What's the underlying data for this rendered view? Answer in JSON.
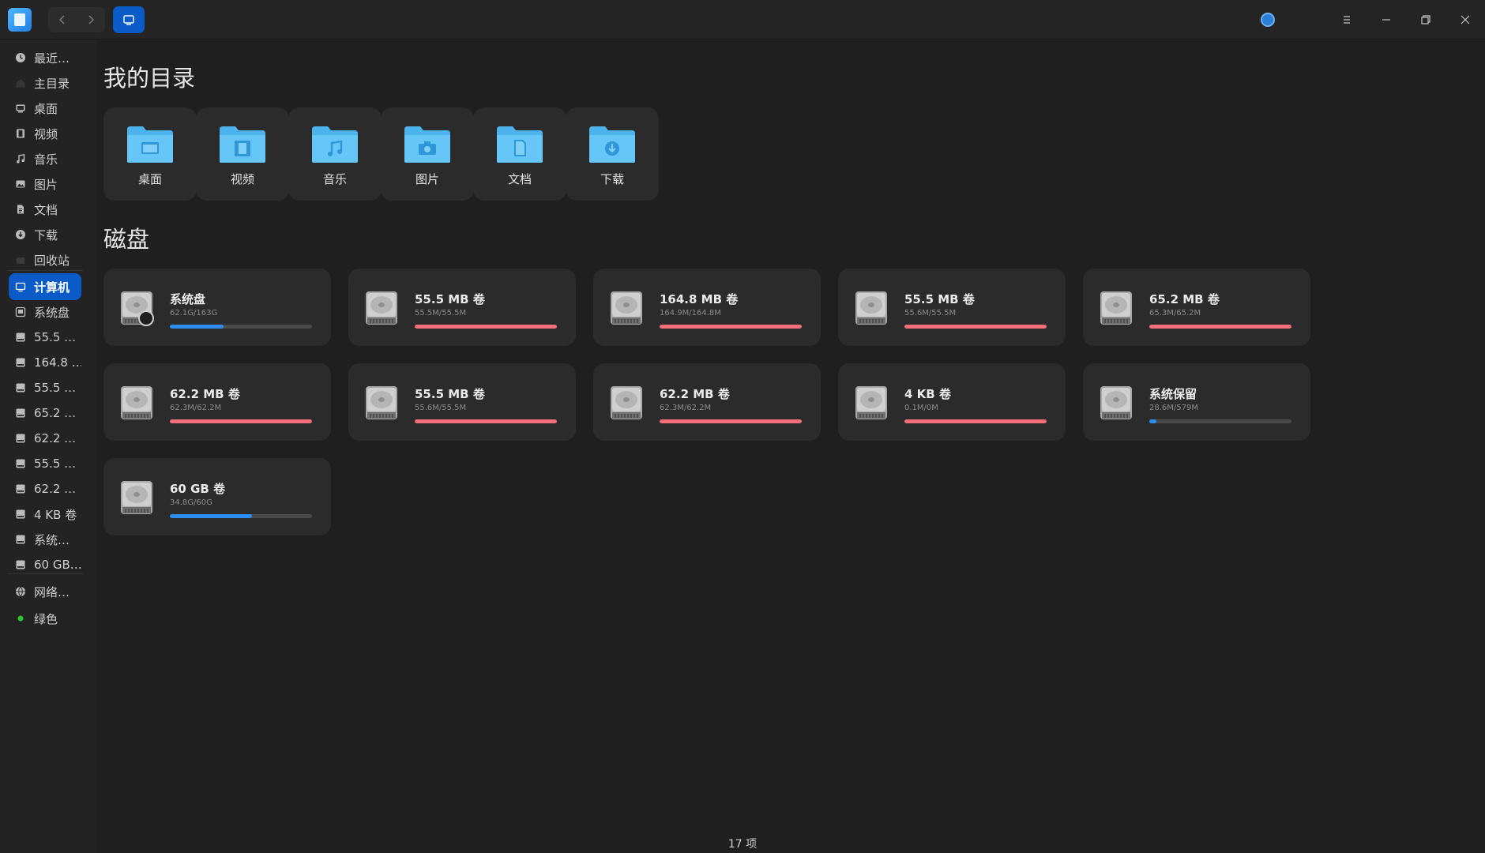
{
  "window": {
    "colors": {
      "accent": "#0a5bc7",
      "bar_blue": "#2c8ef0",
      "bar_red": "#f46f7a",
      "folder": "#5ec1f5"
    }
  },
  "titlebar": {
    "icons": [
      "app-logo",
      "back-icon",
      "forward-icon",
      "computer-view-icon",
      "status-icon",
      "menu-icon",
      "minimize-icon",
      "restore-icon",
      "close-icon"
    ]
  },
  "sidebar": {
    "items": [
      {
        "label": "最近…",
        "icon": "clock-icon"
      },
      {
        "label": "主目录",
        "icon": "home-icon"
      },
      {
        "label": "桌面",
        "icon": "desktop-icon"
      },
      {
        "label": "视频",
        "icon": "film-icon"
      },
      {
        "label": "音乐",
        "icon": "music-icon"
      },
      {
        "label": "图片",
        "icon": "image-icon"
      },
      {
        "label": "文档",
        "icon": "document-icon"
      },
      {
        "label": "下载",
        "icon": "download-icon"
      },
      {
        "label": "回收站",
        "icon": "trash-icon"
      },
      {
        "label": "计算机",
        "icon": "computer-icon"
      },
      {
        "label": "系统盘",
        "icon": "system-disk-icon"
      },
      {
        "label": "55.5 …",
        "icon": "disk-icon"
      },
      {
        "label": "164.8 …",
        "icon": "disk-icon"
      },
      {
        "label": "55.5 …",
        "icon": "disk-icon"
      },
      {
        "label": "65.2 …",
        "icon": "disk-icon"
      },
      {
        "label": "62.2 …",
        "icon": "disk-icon"
      },
      {
        "label": "55.5 …",
        "icon": "disk-icon"
      },
      {
        "label": "62.2 …",
        "icon": "disk-icon"
      },
      {
        "label": "4 KB 卷",
        "icon": "disk-icon"
      },
      {
        "label": "系统…",
        "icon": "disk-icon"
      },
      {
        "label": "60 GB…",
        "icon": "disk-icon"
      },
      {
        "label": "网络…",
        "icon": "network-icon"
      },
      {
        "label": "绿色",
        "icon": "green-tag-icon"
      }
    ]
  },
  "main": {
    "directories_title": "我的目录",
    "directories": [
      {
        "label": "桌面",
        "icon": "desktop-folder-icon"
      },
      {
        "label": "视频",
        "icon": "video-folder-icon"
      },
      {
        "label": "音乐",
        "icon": "music-folder-icon"
      },
      {
        "label": "图片",
        "icon": "pictures-folder-icon"
      },
      {
        "label": "文档",
        "icon": "documents-folder-icon"
      },
      {
        "label": "下载",
        "icon": "downloads-folder-icon"
      }
    ],
    "disks_title": "磁盘",
    "disks": [
      {
        "name": "系统盘",
        "usage": "62.1G/163G",
        "fraction": 0.38,
        "color": "#2c8ef0"
      },
      {
        "name": "55.5 MB 卷",
        "usage": "55.5M/55.5M",
        "fraction": 1.0,
        "color": "#f46f7a"
      },
      {
        "name": "164.8 MB 卷",
        "usage": "164.9M/164.8M",
        "fraction": 1.0,
        "color": "#f46f7a"
      },
      {
        "name": "55.5 MB 卷",
        "usage": "55.6M/55.5M",
        "fraction": 1.0,
        "color": "#f46f7a"
      },
      {
        "name": "65.2 MB 卷",
        "usage": "65.3M/65.2M",
        "fraction": 1.0,
        "color": "#f46f7a"
      },
      {
        "name": "62.2 MB 卷",
        "usage": "62.3M/62.2M",
        "fraction": 1.0,
        "color": "#f46f7a"
      },
      {
        "name": "55.5 MB 卷",
        "usage": "55.6M/55.5M",
        "fraction": 1.0,
        "color": "#f46f7a"
      },
      {
        "name": "62.2 MB 卷",
        "usage": "62.3M/62.2M",
        "fraction": 1.0,
        "color": "#f46f7a"
      },
      {
        "name": "4 KB 卷",
        "usage": "0.1M/0M",
        "fraction": 1.0,
        "color": "#f46f7a"
      },
      {
        "name": "系统保留",
        "usage": "28.6M/579M",
        "fraction": 0.05,
        "color": "#2c8ef0"
      },
      {
        "name": "60 GB 卷",
        "usage": "34.8G/60G",
        "fraction": 0.58,
        "color": "#2c8ef0"
      }
    ]
  },
  "statusbar": {
    "item_count": "17 项"
  }
}
